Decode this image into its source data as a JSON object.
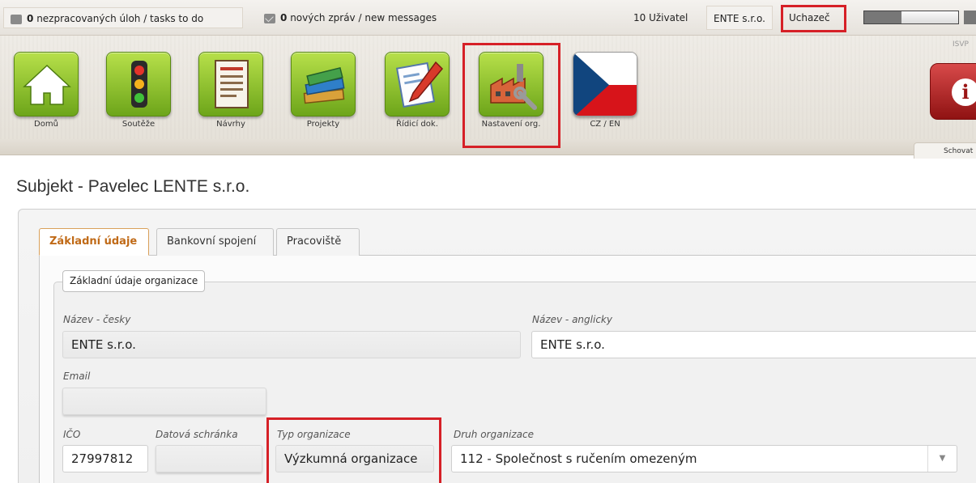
{
  "topbar": {
    "tasks_count": "0",
    "tasks_label": "nezpracovaných úloh / tasks to do",
    "messages_count": "0",
    "messages_label": "nových zpráv / new messages",
    "user_count_label": "10 Uživatel",
    "org_name": "ENTE s.r.o.",
    "role": "Uchazeč",
    "progress_fraction": 0.4
  },
  "toolbar": {
    "items": [
      {
        "label": "Domů",
        "icon": "home-icon"
      },
      {
        "label": "Soutěže",
        "icon": "traffic-light-icon"
      },
      {
        "label": "Návrhy",
        "icon": "document-list-icon"
      },
      {
        "label": "Projekty",
        "icon": "books-icon"
      },
      {
        "label": "Řídicí dok.",
        "icon": "document-pen-icon"
      },
      {
        "label": "Nastavení org.",
        "icon": "factory-tools-icon"
      },
      {
        "label": "CZ / EN",
        "icon": "czech-flag-icon"
      }
    ],
    "isvp_label": "ISVP",
    "info_icon": "info-icon",
    "hide_label": "Schovat"
  },
  "page": {
    "title": "Subjekt - Pavelec LENTE s.r.o."
  },
  "tabs": [
    {
      "label": "Základní údaje",
      "active": true
    },
    {
      "label": "Bankovní spojení",
      "active": false
    },
    {
      "label": "Pracoviště",
      "active": false
    }
  ],
  "form": {
    "legend": "Základní údaje organizace",
    "name_cz_label": "Název - česky",
    "name_cz_value": "ENTE s.r.o.",
    "name_en_label": "Název - anglicky",
    "name_en_value": "ENTE s.r.o.",
    "email_label": "Email",
    "email_value": "",
    "ico_label": "IČO",
    "ico_value": "27997812",
    "databox_label": "Datová schránka",
    "databox_value": "",
    "org_type_label": "Typ organizace",
    "org_type_value": "Výzkumná organizace",
    "org_kind_label": "Druh organizace",
    "org_kind_value": "112 - Společnost s ručením omezeným"
  },
  "colors": {
    "highlight": "#d62027",
    "active_tab": "#c06a17",
    "tile_green": "#8cc230"
  }
}
